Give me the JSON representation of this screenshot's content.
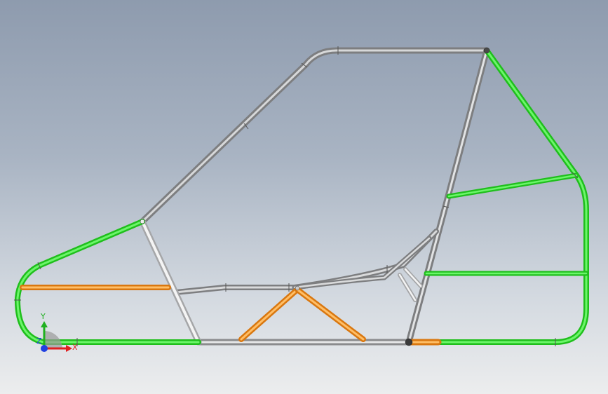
{
  "viewport": {
    "background_top": "#8e9bae",
    "background_bottom": "#ecedee"
  },
  "colors": {
    "gray_tube": "#8f9092",
    "gray_tube_light": "#d2d3d4",
    "white_tube": "#dcdcdc",
    "green_tube": "#22d91f",
    "green_tube_light": "#7cf07a",
    "orange_tube": "#e88a1c",
    "orange_tube_light": "#ffc26b",
    "joint": "#3e3e3e"
  },
  "triad": {
    "x_label": "X",
    "y_label": "Y",
    "z_label": "Z",
    "x_color": "#e02020",
    "y_color": "#20b020",
    "z_color": "#2040e0"
  },
  "tube_groups": [
    {
      "name": "main-hoop-gray",
      "color": "gray"
    },
    {
      "name": "side-members-white",
      "color": "white"
    },
    {
      "name": "secondary-members-green",
      "color": "green"
    },
    {
      "name": "braces-orange",
      "color": "orange"
    }
  ]
}
